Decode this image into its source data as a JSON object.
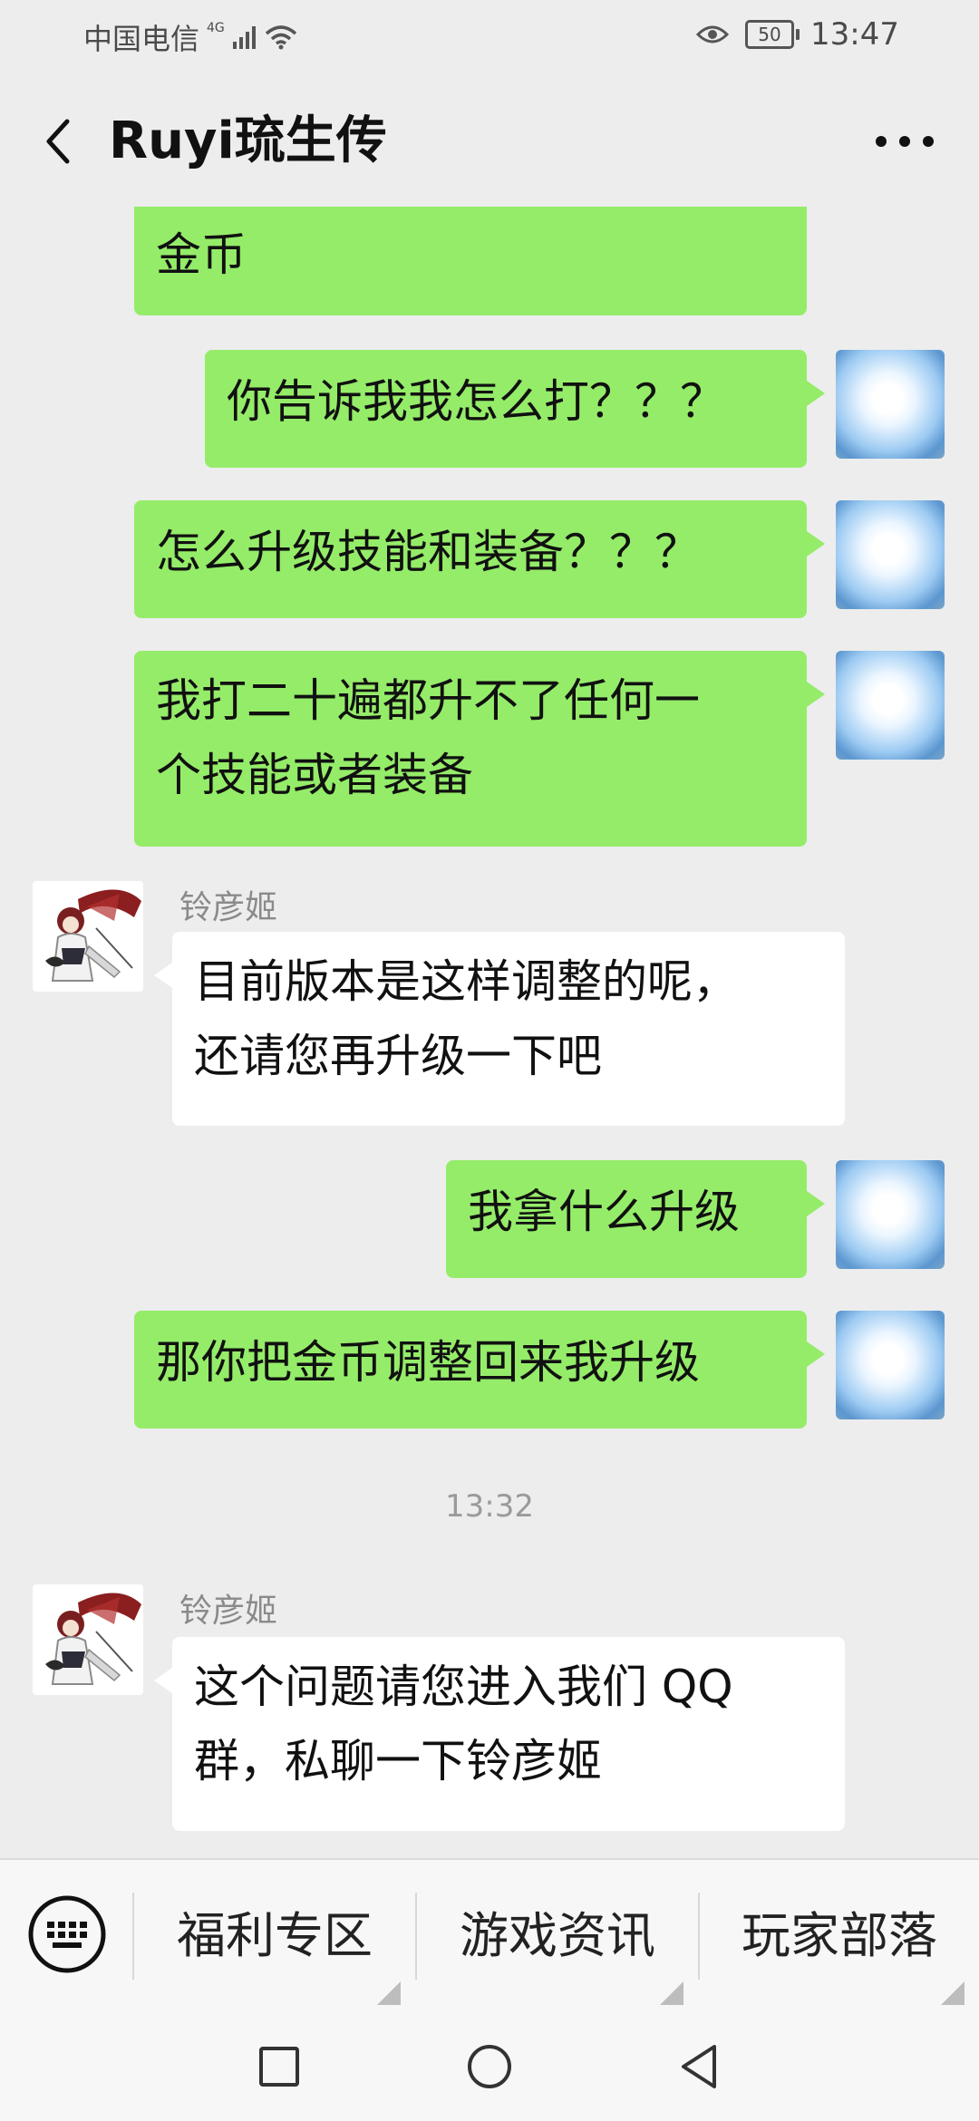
{
  "status_bar": {
    "carrier": "中国电信",
    "network": "4G",
    "battery": "50",
    "time": "13:47"
  },
  "header": {
    "title": "Ruyi琉生传"
  },
  "messages": [
    {
      "type": "out",
      "text": "金币"
    },
    {
      "type": "out",
      "text": "你告诉我我怎么打？？？"
    },
    {
      "type": "out",
      "text": "怎么升级技能和装备？？？"
    },
    {
      "type": "out",
      "text_line1": "我打二十遍都升不了任何一",
      "text_line2": "个技能或者装备"
    },
    {
      "type": "in",
      "sender": "铃彦姬",
      "text_line1": "目前版本是这样调整的呢，",
      "text_line2": "还请您再升级一下吧"
    },
    {
      "type": "out",
      "text": "我拿什么升级"
    },
    {
      "type": "out",
      "text": "那你把金币调整回来我升级"
    },
    {
      "type": "time",
      "text": "13:32"
    },
    {
      "type": "in",
      "sender": "铃彦姬",
      "text_line1": "这个问题请您进入我们 QQ",
      "text_line2": "群，私聊一下铃彦姬"
    }
  ],
  "menu": {
    "items": [
      "福利专区",
      "游戏资讯",
      "玩家部落"
    ]
  },
  "icons": {
    "back": "back-arrow-icon",
    "more": "more-dots-icon",
    "keyboard": "keyboard-icon",
    "eye": "eye-icon",
    "wifi": "wifi-icon"
  },
  "colors": {
    "outgoing_bubble": "#95ec69",
    "incoming_bubble": "#ffffff",
    "background": "#ededed"
  }
}
